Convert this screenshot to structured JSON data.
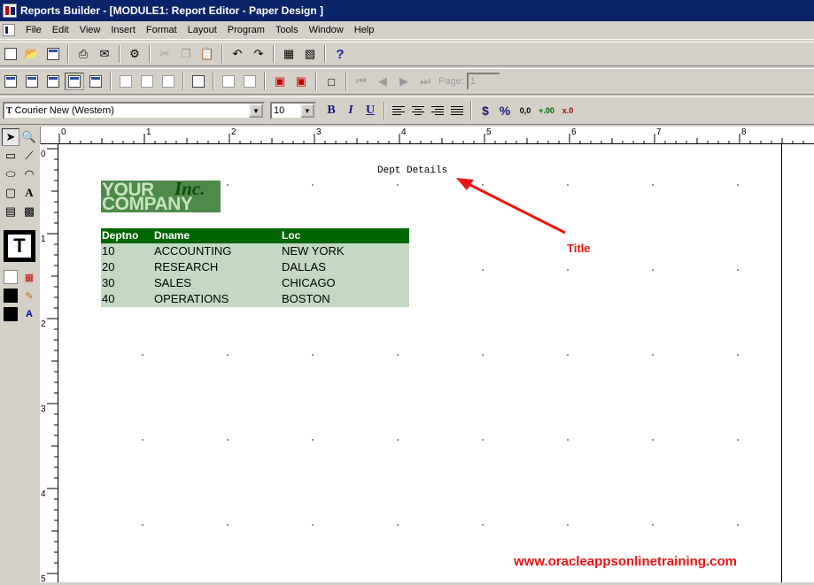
{
  "window": {
    "title": "Reports Builder - [MODULE1: Report Editor - Paper Design ]"
  },
  "menu": [
    "File",
    "Edit",
    "View",
    "Insert",
    "Format",
    "Layout",
    "Program",
    "Tools",
    "Window",
    "Help"
  ],
  "toolbar": {
    "page_label": "Page:",
    "page_value": "1"
  },
  "format_bar": {
    "font": "Courier New (Western)",
    "size": "10",
    "bold": "B",
    "italic": "I",
    "underline": "U",
    "currency": "$",
    "percent": "%"
  },
  "palette": {
    "text_tool": "A",
    "big_text": "T"
  },
  "rulers": {
    "h_ticks": [
      "0",
      "1",
      "2",
      "3",
      "4",
      "5",
      "6",
      "7",
      "8"
    ],
    "v_ticks": [
      "0",
      "1",
      "2",
      "3",
      "4",
      "5"
    ]
  },
  "report": {
    "title": "Dept Details",
    "logo": {
      "line1": "YOUR",
      "inc": "Inc.",
      "line2": "COMPANY"
    },
    "columns": [
      "Deptno",
      "Dname",
      "Loc"
    ],
    "rows": [
      [
        "10",
        "ACCOUNTING",
        "NEW YORK"
      ],
      [
        "20",
        "RESEARCH",
        "DALLAS"
      ],
      [
        "30",
        "SALES",
        "CHICAGO"
      ],
      [
        "40",
        "OPERATIONS",
        "BOSTON"
      ]
    ]
  },
  "annotation": {
    "label": "Title"
  },
  "watermark": "www.oracleappsonlinetraining.com",
  "colors": {
    "titlebar": "#0a246a",
    "header_bg": "#006600",
    "row_bg": "#c3d9c3",
    "annotation": "#ee1111",
    "logo_bg": "#4f8a4a"
  }
}
